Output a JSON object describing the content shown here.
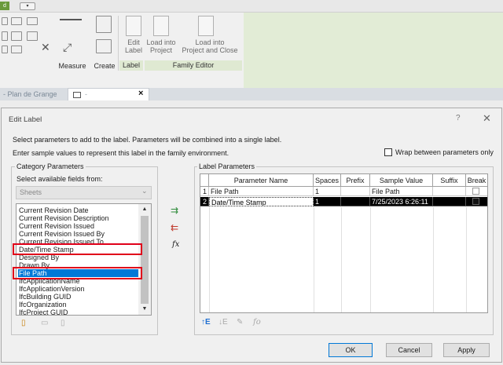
{
  "ribbon": {
    "tools": [
      {
        "id": "measure",
        "label": "Measure"
      },
      {
        "id": "create",
        "label": "Create"
      }
    ],
    "label_panel": {
      "edit_label": "Edit\nLabel",
      "panel_title": "Label"
    },
    "family_editor": {
      "load_into_project": "Load into\nProject",
      "load_and_close": "Load into\nProject and Close",
      "panel_title": "Family Editor"
    }
  },
  "tabs": {
    "inactive": "- Plan de Grange",
    "active": "-",
    "close": "×"
  },
  "dialog": {
    "title": "Edit Label",
    "help": "?",
    "close": "✕",
    "instruction1": "Select parameters to add to the label.  Parameters will be combined into a single label.",
    "instruction2": "Enter sample values to represent this label in the family environment.",
    "wrap_label": "Wrap between parameters only",
    "wrap_checked": false,
    "category": {
      "title": "Category Parameters",
      "select_label": "Select available fields from:",
      "select_value": "Sheets",
      "items": [
        "Current Revision Date",
        "Current Revision Description",
        "Current Revision Issued",
        "Current Revision Issued By",
        "Current Revision Issued To",
        "Date/Time Stamp",
        "Designed By",
        "Drawn By",
        "File Path",
        "IfcApplicationName",
        "IfcApplicationVersion",
        "IfcBuilding GUID",
        "IfcOrganization",
        "IfcProject GUID"
      ],
      "selected_item": "File Path"
    },
    "label_params": {
      "title": "Label Parameters",
      "columns": [
        "Parameter Name",
        "Spaces",
        "Prefix",
        "Sample Value",
        "Suffix",
        "Break"
      ],
      "rows": [
        {
          "num": "1",
          "name": "File Path",
          "spaces": "1",
          "prefix": "",
          "sample": "File Path",
          "suffix": ""
        },
        {
          "num": "2",
          "name": "Date/Time Stamp",
          "spaces": "1",
          "prefix": "",
          "sample": "7/25/2023 6:26:11",
          "suffix": ""
        }
      ]
    },
    "buttons": {
      "ok": "OK",
      "cancel": "Cancel",
      "apply": "Apply"
    }
  },
  "colors": {
    "selection": "#0078d7",
    "highlight_box": "#e0001a",
    "ribbon_green": "#e2ecd6"
  }
}
